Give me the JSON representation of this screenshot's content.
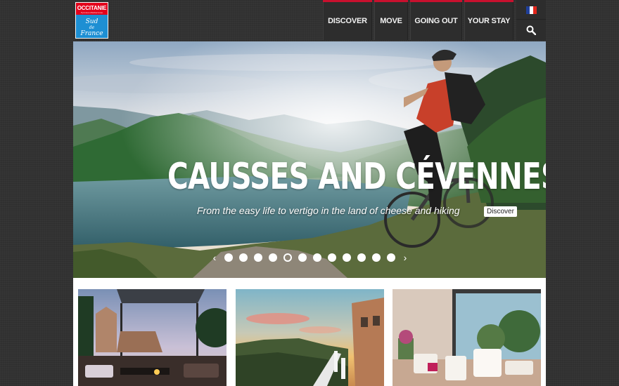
{
  "brand": {
    "name": "OCCITANIE",
    "tagline": "Pyrénées-Méditerranée",
    "sub_line1": "Sud",
    "sub_line2": "de",
    "sub_line3": "France",
    "red": "#e3001b",
    "blue": "#1d8fd3"
  },
  "nav": {
    "discover": "DISCOVER",
    "move": "MOVE",
    "going_out": "GOING OUT",
    "your_stay": "YOUR STAY",
    "accent": "#c8102e"
  },
  "language": {
    "icon": "french-flag-icon",
    "colors": [
      "#1f3f9a",
      "#ffffff",
      "#e1251b"
    ]
  },
  "search": {
    "icon": "search-icon"
  },
  "hero": {
    "title": "CAUSSES AND CÉVENNES",
    "subtitle": "From the easy life to vertigo in the land of cheese and hiking",
    "cta": "Discover",
    "prev_icon": "chevron-left-icon",
    "next_icon": "chevron-right-icon",
    "slide_count": 12,
    "active_slide": 5
  },
  "cards": [
    {
      "image": "castle-terrace-photo"
    },
    {
      "image": "sunset-terrace-photo"
    },
    {
      "image": "lounge-interior-photo"
    }
  ]
}
